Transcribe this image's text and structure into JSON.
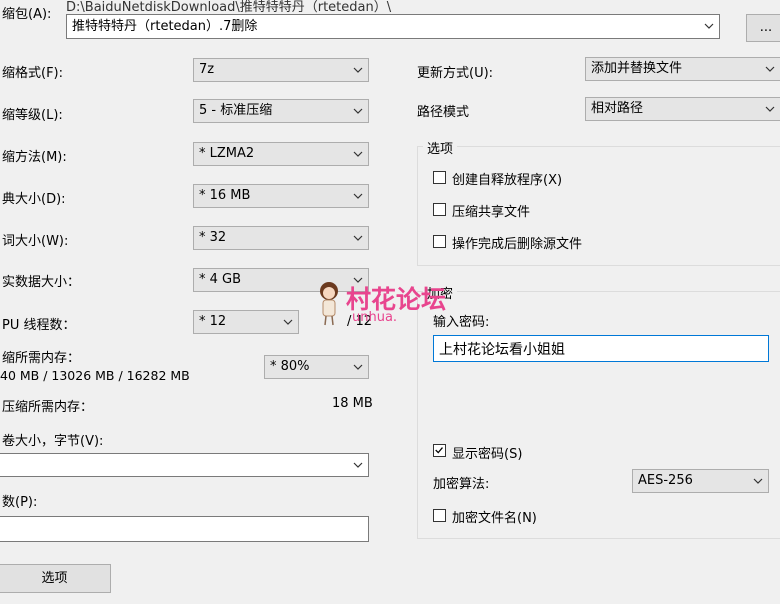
{
  "archive": {
    "label": "缩包(A):",
    "path_hint": "D:\\BaiduNetdiskDownload\\推特特特丹（rtetedan）\\",
    "filename": "推特特特丹（rtetedan）.7删除",
    "browse_label": "..."
  },
  "left": {
    "format": {
      "label": "缩格式(F):",
      "value": "7z"
    },
    "level": {
      "label": "缩等级(L):",
      "value": "5 - 标准压缩"
    },
    "method": {
      "label": "缩方法(M):",
      "value": "* LZMA2"
    },
    "dict": {
      "label": "典大小(D):",
      "value": "* 16 MB"
    },
    "word": {
      "label": "词大小(W):",
      "value": "* 32"
    },
    "solid": {
      "label": "实数据大小：",
      "value": "* 4 GB"
    },
    "threads": {
      "label": "PU 线程数：",
      "value": "* 12",
      "max": "/ 12"
    },
    "mem_compress": {
      "label": "缩所需内存：",
      "detail": "40 MB / 13026 MB / 16282 MB",
      "value": "* 80%"
    },
    "mem_decompress": {
      "label": "压缩所需内存：",
      "value": "18 MB"
    },
    "volume": {
      "label": "卷大小，字节(V):",
      "value": ""
    },
    "params": {
      "label": "数(P):",
      "value": ""
    },
    "options_button": "选项"
  },
  "right": {
    "update": {
      "label": "更新方式(U):",
      "value": "添加并替换文件"
    },
    "path_mode": {
      "label": "路径模式",
      "value": "相对路径"
    },
    "options": {
      "title": "选项",
      "sfx": "创建自释放程序(X)",
      "shared": "压缩共享文件",
      "delete_after": "操作完成后删除源文件"
    },
    "encryption": {
      "title": "加密",
      "password_label": "输入密码:",
      "password_value": "上村花论坛看小姐姐",
      "show_password": "显示密码(S)",
      "algo_label": "加密算法:",
      "algo_value": "AES-256",
      "encrypt_names": "加密文件名(N)"
    }
  },
  "watermark": {
    "text": "村花论坛",
    "sub": "unhua."
  },
  "colors": {
    "watermark": "#e8458e",
    "group_border": "#dcdcdc"
  }
}
